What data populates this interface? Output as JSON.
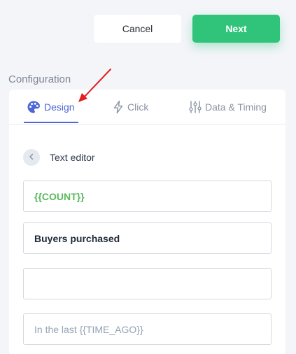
{
  "toolbar": {
    "cancel_label": "Cancel",
    "next_label": "Next"
  },
  "section": {
    "title": "Configuration"
  },
  "tabs": [
    {
      "label": "Design",
      "icon": "palette-icon",
      "active": true
    },
    {
      "label": "Click",
      "icon": "lightning-icon",
      "active": false
    },
    {
      "label": "Data & Timing",
      "icon": "sliders-icon",
      "active": false
    }
  ],
  "editor": {
    "title": "Text editor",
    "fields": [
      {
        "value": "{{COUNT}}"
      },
      {
        "value": "Buyers purchased"
      },
      {
        "value": ""
      },
      {
        "value": "In the last {{TIME_AGO}}"
      }
    ]
  },
  "colors": {
    "accent": "#4f66d6",
    "primary_button": "#2fc47a",
    "variable_text": "#58b85c",
    "annotation_arrow": "#e02020"
  }
}
